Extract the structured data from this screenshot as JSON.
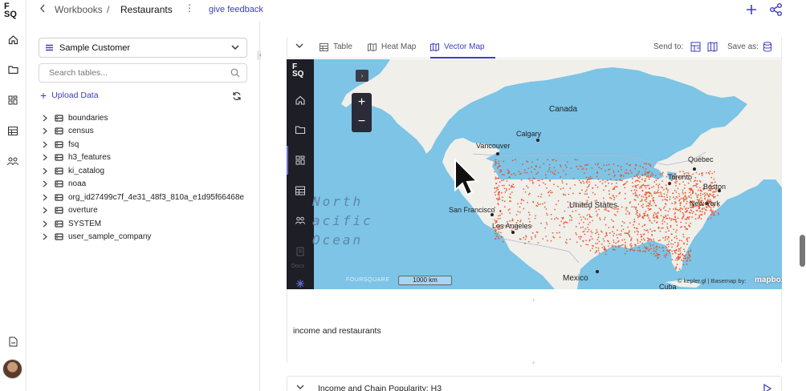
{
  "rail": {
    "logo": "F\nSQ",
    "icons": [
      "home-icon",
      "folder-icon",
      "dashboard-icon",
      "table-icon",
      "users-icon",
      "file-icon"
    ]
  },
  "breadcrumb": {
    "workbooks": "Workbooks",
    "separator": "/",
    "title": "Restaurants",
    "more": "⋮",
    "feedback": "give feedback"
  },
  "sidebar": {
    "workspace": "Sample Customer",
    "search_placeholder": "Search tables...",
    "upload": "Upload Data",
    "tables": [
      "boundaries",
      "census",
      "fsq",
      "h3_features",
      "ki_catalog",
      "noaa",
      "org_id27499c7f_4e31_48f3_810a_e1d95f66468e",
      "overture",
      "SYSTEM",
      "user_sample_company"
    ]
  },
  "cell": {
    "tabs": [
      {
        "label": "Table",
        "icon": "table-icon"
      },
      {
        "label": "Heat Map",
        "icon": "map-icon"
      },
      {
        "label": "Vector Map",
        "icon": "map-icon",
        "active": true
      }
    ],
    "send_to": "Send to:",
    "save_as": "Save as:"
  },
  "map": {
    "logo": "F\nSQ",
    "docs": "Docs",
    "zoom_in": "+",
    "zoom_out": "−",
    "labels": {
      "canada": "Canada",
      "calgary": "Calgary",
      "vancouver": "Vancouver",
      "quebec": "Québec",
      "toronto": "Toronto",
      "boston": "Boston",
      "new_york": "New York",
      "united_states": "United States",
      "san_francisco": "San Francisco",
      "los_angeles": "Los Angeles",
      "mexico": "Mexico",
      "cuba": "Cuba",
      "ocean_1": "North",
      "ocean_2": "acific",
      "ocean_3": "Ocean"
    },
    "scale": "1000 km",
    "footer_logo": "FOURSQUARE",
    "attribution": "© kepler.gl | Basemap by:",
    "mapbox": "mapbox",
    "colors": {
      "water": "#7dc4e6",
      "land": "#f0efea",
      "points": "#e8491c"
    }
  },
  "text_cell": "income and restaurants",
  "next_cell": "Income and Chain Popularity: H3"
}
